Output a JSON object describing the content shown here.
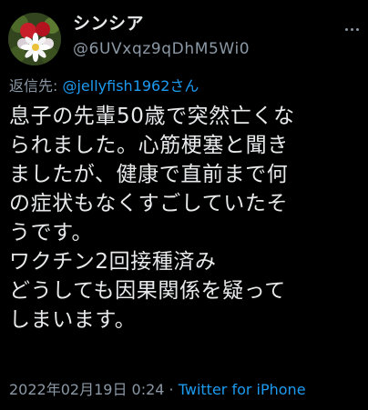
{
  "author": {
    "display_name": "シンシア",
    "handle": "@6UVxqz9qDhM5Wi0",
    "avatar_icon": "flower-bouquet-avatar"
  },
  "reply": {
    "prefix": "返信先: ",
    "mention": "@jellyfish1962さん"
  },
  "tweet": {
    "lines": [
      "息子の先輩50歳で突然亡くな",
      "られました。心筋梗塞と聞き",
      "ましたが、健康で直前まで何",
      "の症状もなくすごしていたそ",
      "うです。",
      "ワクチン2回接種済み",
      "どうしても因果関係を疑って",
      "しまいます。"
    ]
  },
  "meta": {
    "timestamp": "2022年02月19日 0:24",
    "separator": " · ",
    "source": "Twitter for iPhone"
  },
  "colors": {
    "background": "#000000",
    "text": "#e7e9ea",
    "secondary": "#8b98a5",
    "link": "#1d9bf0"
  }
}
